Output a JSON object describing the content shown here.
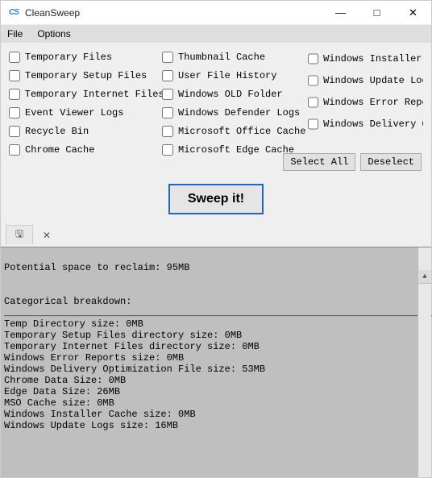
{
  "window": {
    "logo_text": "CS",
    "title": "CleanSweep",
    "min": "—",
    "max": "□",
    "close": "✕"
  },
  "menu": {
    "file": "File",
    "options": "Options"
  },
  "checkboxes": {
    "col1": [
      "Temporary Files",
      "Temporary Setup Files",
      "Temporary Internet Files",
      "Event Viewer Logs",
      "Recycle Bin",
      "Chrome Cache"
    ],
    "col2": [
      "Thumbnail Cache",
      "User File History",
      "Windows OLD Folder",
      "Windows Defender Logs",
      "Microsoft Office Cache",
      "Microsoft Edge Cache"
    ],
    "col3": [
      "Windows Installer Cache",
      "Windows Update Logs",
      "Windows Error Reports",
      "Windows Delivery Optimizat"
    ]
  },
  "buttons": {
    "select_all": "Select All",
    "deselect": "Deselect",
    "sweep": "Sweep it!"
  },
  "tabs": {
    "save_glyph": "🖫",
    "close_glyph": "✕"
  },
  "report": {
    "line_potential": "Potential space to reclaim: 95MB",
    "line_breakdown": "Categorical breakdown:",
    "rule": "________________________________________________________________________\n_________________________________________",
    "lines": [
      "Temp Directory size: 0MB",
      "Temporary Setup Files directory size: 0MB",
      "Temporary Internet Files directory size: 0MB",
      "Windows Error Reports size: 0MB",
      "Windows Delivery Optimization File size: 53MB",
      "Chrome Data Size: 0MB",
      "Edge Data Size: 26MB",
      "MSO Cache size: 0MB",
      "Windows Installer Cache size: 0MB",
      "Windows Update Logs size: 16MB"
    ]
  },
  "chart_data": {
    "type": "table",
    "title": "Potential space to reclaim: 95MB",
    "series": [
      {
        "name": "Temp Directory",
        "values": [
          0
        ],
        "unit": "MB"
      },
      {
        "name": "Temporary Setup Files directory",
        "values": [
          0
        ],
        "unit": "MB"
      },
      {
        "name": "Temporary Internet Files directory",
        "values": [
          0
        ],
        "unit": "MB"
      },
      {
        "name": "Windows Error Reports",
        "values": [
          0
        ],
        "unit": "MB"
      },
      {
        "name": "Windows Delivery Optimization File",
        "values": [
          53
        ],
        "unit": "MB"
      },
      {
        "name": "Chrome Data",
        "values": [
          0
        ],
        "unit": "MB"
      },
      {
        "name": "Edge Data",
        "values": [
          26
        ],
        "unit": "MB"
      },
      {
        "name": "MSO Cache",
        "values": [
          0
        ],
        "unit": "MB"
      },
      {
        "name": "Windows Installer Cache",
        "values": [
          0
        ],
        "unit": "MB"
      },
      {
        "name": "Windows Update Logs",
        "values": [
          16
        ],
        "unit": "MB"
      }
    ]
  }
}
